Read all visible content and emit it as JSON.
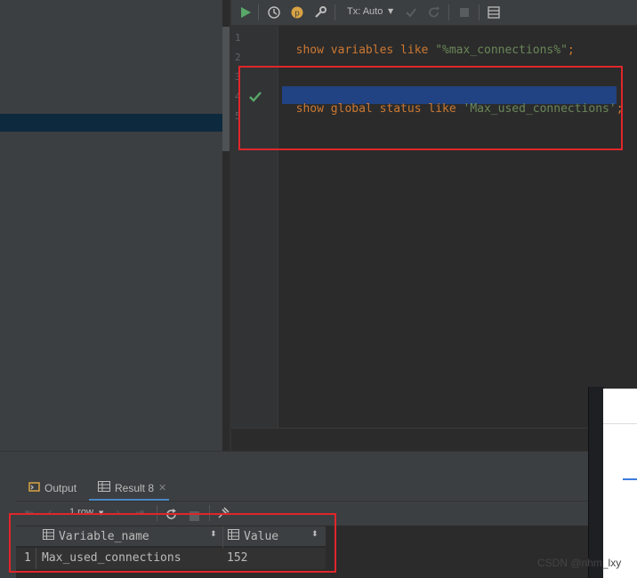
{
  "toolbar": {
    "run_icon": "play-icon",
    "history_icon": "clock-icon",
    "profile_icon": "p-badge-icon",
    "settings_icon": "wrench-icon",
    "tx_mode": "Tx: Auto",
    "commit_icon": "check-icon",
    "rollback_icon": "undo-icon",
    "stop_icon": "stop-icon",
    "output_icon": "table-icon",
    "colors": {
      "run": "#59a869",
      "profile": "#d9a343"
    }
  },
  "editor": {
    "lines": [
      {
        "number": "1",
        "tokens": [
          {
            "t": "show variables like ",
            "c": "kw"
          },
          {
            "t": "\"%max_connections%\"",
            "c": "str"
          },
          {
            "t": ";",
            "c": "kw"
          }
        ]
      },
      {
        "number": "2",
        "tokens": []
      },
      {
        "number": "3",
        "tokens": []
      },
      {
        "number": "4",
        "tokens": [
          {
            "t": "show global status like ",
            "c": "kw"
          },
          {
            "t": "'Max_used_connections'",
            "c": "str"
          },
          {
            "t": ";",
            "c": "kw"
          }
        ]
      },
      {
        "number": "5",
        "tokens": []
      }
    ],
    "executed_marker_icon": "checkmark-icon",
    "colors": {
      "keyword": "#cc7832",
      "string": "#6a8759",
      "selection": "#214283",
      "highlight_box": "#e0262b"
    }
  },
  "services": {
    "tabs": [
      {
        "label": "Output",
        "icon": "output-icon"
      },
      {
        "label": "Result 8",
        "icon": "table-icon",
        "closable": true
      }
    ],
    "navigation": {
      "row_count": "1 row",
      "first_icon": "first-page-icon",
      "prev_icon": "prev-icon",
      "next_icon": "next-icon",
      "last_icon": "last-page-icon",
      "refresh_icon": "refresh-icon",
      "stop_icon": "stop-icon",
      "pin_icon": "pin-icon"
    },
    "table": {
      "columns": [
        "Variable_name",
        "Value"
      ],
      "rows": [
        {
          "index": "1",
          "cells": [
            "Max_used_connections",
            "152"
          ]
        }
      ]
    }
  },
  "watermark": "CSDN @nhm_lxy"
}
